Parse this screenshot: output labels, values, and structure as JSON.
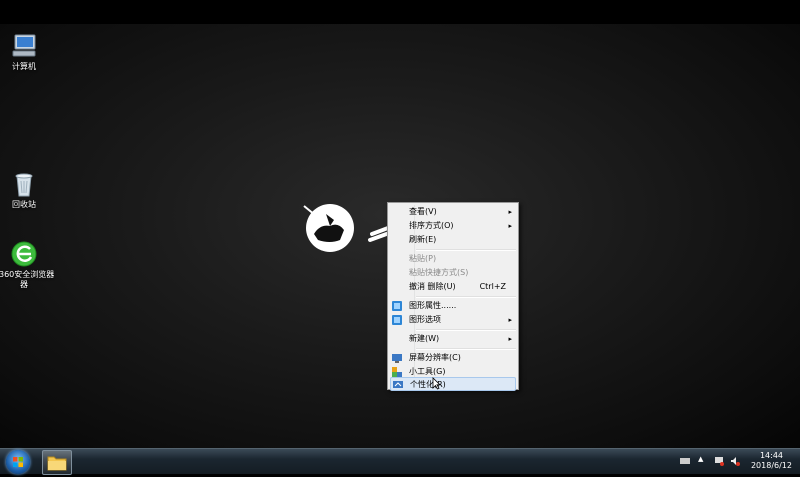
{
  "desktop": {
    "icons": [
      {
        "label": "计算机",
        "icon": "computer-icon"
      },
      {
        "label": "回收站",
        "icon": "recycle-bin-icon"
      },
      {
        "label": "360安全浏览器",
        "label_line2": "器",
        "icon": "browser-360-icon"
      }
    ]
  },
  "context_menu": {
    "items": [
      {
        "label": "查看(V)",
        "submenu": true,
        "enabled": true
      },
      {
        "label": "排序方式(O)",
        "submenu": true,
        "enabled": true
      },
      {
        "label": "刷新(E)",
        "enabled": true
      },
      {
        "label": "粘贴(P)",
        "enabled": false
      },
      {
        "label": "粘贴快捷方式(S)",
        "enabled": false
      },
      {
        "label": "撤消 删除(U)",
        "shortcut": "Ctrl+Z",
        "enabled": true
      },
      {
        "label": "图形属性......",
        "enabled": true,
        "icon": "graphics-properties-icon"
      },
      {
        "label": "图形选项",
        "submenu": true,
        "enabled": true,
        "icon": "graphics-options-icon"
      },
      {
        "label": "新建(W)",
        "submenu": true,
        "enabled": true
      },
      {
        "label": "屏幕分辨率(C)",
        "enabled": true,
        "icon": "screen-resolution-icon"
      },
      {
        "label": "小工具(G)",
        "enabled": true,
        "icon": "gadgets-icon"
      },
      {
        "label": "个性化(R)",
        "enabled": true,
        "highlighted": true,
        "icon": "personalize-icon"
      }
    ],
    "submenu_arrow": "▸"
  },
  "taskbar": {
    "clock_time": "14:44",
    "clock_date": "2018/6/12"
  },
  "colors": {
    "menu_bg": "#f0f0f0",
    "highlight": "#dce8f6",
    "taskbar": "#1b2630"
  }
}
